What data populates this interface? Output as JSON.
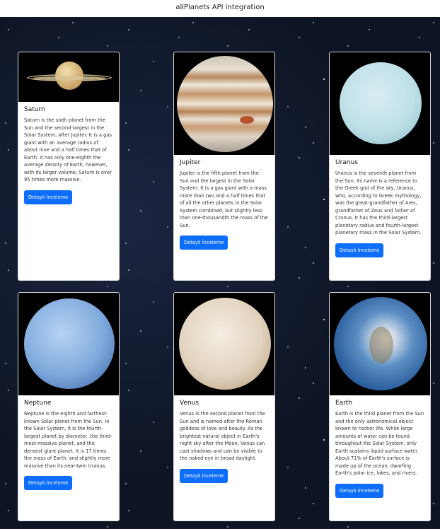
{
  "page": {
    "title": "allPlanets API integration"
  },
  "cards": [
    {
      "name": "Saturn",
      "description": "Saturn is the sixth planet from the Sun and the second-largest in the Solar System, after Jupiter. It is a gas giant with an average radius of about nine and a half times that of Earth. It has only one-eighth the average density of Earth; however, with its larger volume, Saturn is over 95 times more massive.",
      "button": "Detaylı İnceleme"
    },
    {
      "name": "Jupiter",
      "description": "Jupiter is the fifth planet from the Sun and the largest in the Solar System. It is a gas giant with a mass more than two and a half times that of all the other planets in the Solar System combined, but slightly less than one-thousandth the mass of the Sun.",
      "button": "Detaylı İnceleme"
    },
    {
      "name": "Uranus",
      "description": "Uranus is the seventh planet from the Sun. Its name is a reference to the Greek god of the sky, Uranus, who, according to Greek mythology, was the great-grandfather of Ares, grandfather of Zeus and father of Cronus. It has the third-largest planetary radius and fourth-largest planetary mass in the Solar System.",
      "button": "Detaylı İnceleme"
    },
    {
      "name": "Neptune",
      "description": "Neptune is the eighth and farthest-known Solar planet from the Sun. In the Solar System, it is the fourth-largest planet by diameter, the third-most-massive planet, and the densest giant planet. It is 17 times the mass of Earth, and slightly more massive than its near-twin Uranus.",
      "button": "Detaylı İnceleme"
    },
    {
      "name": "Venus",
      "description": "Venus is the second planet from the Sun and is named after the Roman goddess of love and beauty. As the brightest natural object in Earth's night sky after the Moon, Venus can cast shadows and can be visible to the naked eye in broad daylight.",
      "button": "Detaylı İnceleme"
    },
    {
      "name": "Earth",
      "description": "Earth is the third planet from the Sun and the only astronomical object known to harbor life. While large amounts of water can be found throughout the Solar System, only Earth sustains liquid surface water. About 71% of Earth's surface is made up of the ocean, dwarfing Earth's polar ice, lakes, and rivers.",
      "button": "Detaylı İnceleme"
    }
  ],
  "colors": {
    "button": "#0d6efd",
    "background": "#0d1424"
  }
}
